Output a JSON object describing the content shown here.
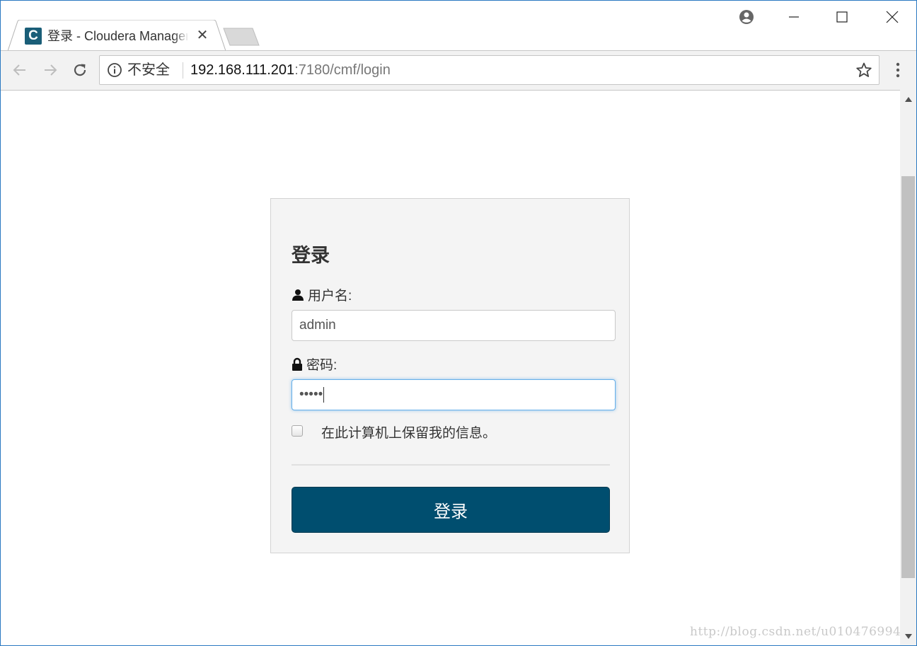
{
  "browser": {
    "tab": {
      "favicon_letter": "C",
      "title": "登录 - Cloudera Manager",
      "close": "✕"
    },
    "address_bar": {
      "security_label": "不安全",
      "url_host": "192.168.111.201",
      "url_rest": ":7180/cmf/login"
    },
    "icons": [
      "account-icon",
      "minimize-icon",
      "maximize-icon",
      "close-icon",
      "back-icon",
      "forward-icon",
      "reload-icon",
      "info-icon",
      "star-icon",
      "menu-icon"
    ]
  },
  "login": {
    "heading": "登录",
    "username_label": "用户名:",
    "username_value": "admin",
    "password_label": "密码:",
    "password_value": "•••••",
    "remember_label": "在此计算机上保留我的信息。",
    "submit_label": "登录"
  },
  "watermark": "http://blog.csdn.net/u010476994",
  "colors": {
    "button": "#004e6f",
    "favicon": "#1a5e78",
    "focus_border": "#66afe9"
  }
}
